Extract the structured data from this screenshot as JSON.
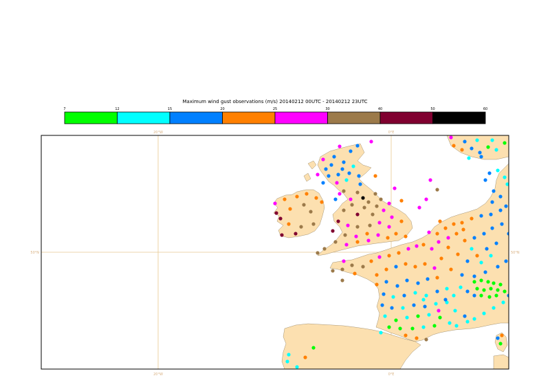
{
  "title": "Maximum wind gust observations (m/s) 20140212 00UTC - 20140212 23UTC",
  "legend": {
    "breaks": [
      "7",
      "12",
      "15",
      "20",
      "25",
      "30",
      "40",
      "50",
      "60"
    ],
    "colors": [
      "#00ff00",
      "#00ffff",
      "#0080ff",
      "#ff8000",
      "#ff00ff",
      "#9c7a4a",
      "#800030",
      "#000000"
    ]
  },
  "map": {
    "land_color": "#fce0b0",
    "sea_color": "#ffffff",
    "grid_color": "#e8c890",
    "grid_labels": {
      "lon_top": [
        "20°W",
        "0°E"
      ],
      "lon_bottom": [
        "20°W",
        "0°E"
      ],
      "lat_left": [
        "50°N"
      ],
      "lat_right": [
        "50°N"
      ]
    }
  }
}
